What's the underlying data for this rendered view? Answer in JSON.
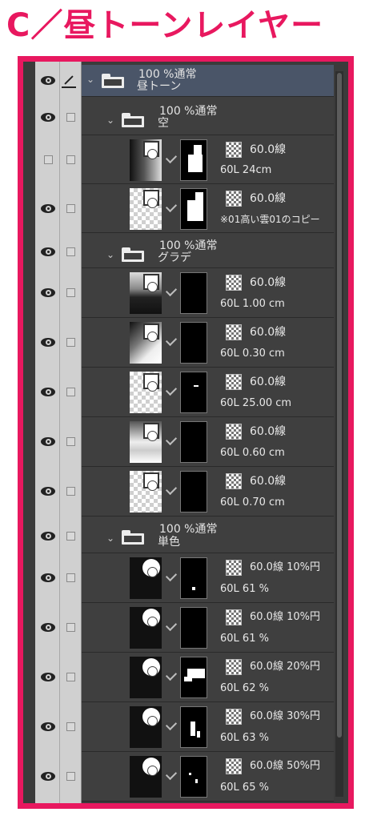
{
  "title": "C／昼トーンレイヤー",
  "layers": {
    "root": {
      "opacity": "100 %通常",
      "name": "昼トーン"
    },
    "sky": {
      "opacity": "100 %通常",
      "name": "空",
      "items": [
        {
          "tone": "60.0線",
          "detail": "60L 24cm"
        },
        {
          "tone": "60.0線",
          "detail": "※01高い雲01のコピー"
        }
      ]
    },
    "grade": {
      "opacity": "100 %通常",
      "name": "グラデ",
      "items": [
        {
          "tone": "60.0線",
          "detail": "60L 1.00 cm"
        },
        {
          "tone": "60.0線",
          "detail": "60L 0.30 cm"
        },
        {
          "tone": "60.0線",
          "detail": "60L 25.00 cm"
        },
        {
          "tone": "60.0線",
          "detail": "60L 0.60 cm"
        },
        {
          "tone": "60.0線",
          "detail": "60L 0.70 cm"
        }
      ]
    },
    "mono": {
      "opacity": "100 %通常",
      "name": "単色",
      "items": [
        {
          "tone": "60.0線 10%円",
          "detail": "60L 61 %"
        },
        {
          "tone": "60.0線 10%円",
          "detail": "60L 61 %"
        },
        {
          "tone": "60.0線 20%円",
          "detail": "60L 62 %"
        },
        {
          "tone": "60.0線 30%円",
          "detail": "60L 63 %"
        },
        {
          "tone": "60.0線 50%円",
          "detail": "60L 65 %"
        }
      ]
    }
  },
  "icons": {
    "visibility": "eye-icon",
    "lock": "checkbox-icon",
    "edit": "pencil-icon",
    "folder": "folder-icon",
    "expand": "chevron-down-icon",
    "tone": "tone-pattern-icon"
  },
  "colors": {
    "accent": "#e8185f",
    "panel": "#3b3b3b",
    "selected": "#4a5568"
  }
}
